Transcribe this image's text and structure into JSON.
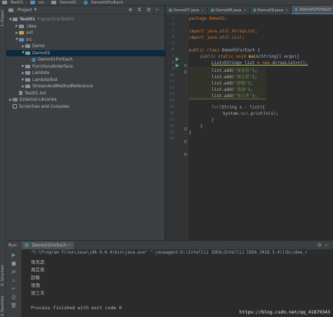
{
  "breadcrumb": [
    "Test01",
    "src",
    "Demo02",
    "Demo01ForEach"
  ],
  "project_panel": {
    "title": "Project",
    "tree": [
      {
        "label": "Test01",
        "suffix": "F:\\practice\\Test01",
        "depth": 0,
        "expanded": true,
        "icon": "folder-plain"
      },
      {
        "label": ".idea",
        "depth": 1,
        "expanded": false,
        "icon": "folder-plain"
      },
      {
        "label": "out",
        "depth": 1,
        "expanded": false,
        "icon": "folder-orange"
      },
      {
        "label": "src",
        "depth": 1,
        "expanded": true,
        "icon": "folder-blue"
      },
      {
        "label": "Demo",
        "depth": 2,
        "expanded": false,
        "icon": "folder-plain"
      },
      {
        "label": "Demo02",
        "depth": 2,
        "expanded": true,
        "icon": "folder-plain",
        "selected": true
      },
      {
        "label": "Demo01ForEach",
        "depth": 3,
        "icon": "class"
      },
      {
        "label": "FunctionalInterface",
        "depth": 2,
        "expanded": false,
        "icon": "folder-plain"
      },
      {
        "label": "Lambda",
        "depth": 2,
        "expanded": false,
        "icon": "folder-plain"
      },
      {
        "label": "LambdaTest",
        "depth": 2,
        "expanded": false,
        "icon": "folder-plain"
      },
      {
        "label": "StreamAndMethodReference",
        "depth": 2,
        "expanded": false,
        "icon": "folder-plain"
      },
      {
        "label": "Test01.iml",
        "depth": 1,
        "icon": "file"
      },
      {
        "label": "External Libraries",
        "depth": 0,
        "expanded": false,
        "icon": "library"
      },
      {
        "label": "Scratches and Consoles",
        "depth": 0,
        "icon": "scratch"
      }
    ]
  },
  "editor": {
    "tabs": [
      {
        "label": "Demo07.java",
        "active": false
      },
      {
        "label": "Demo08.java",
        "active": false
      },
      {
        "label": "Demo09.java",
        "active": false
      },
      {
        "label": "Demo01ForEach",
        "active": true
      }
    ],
    "line_numbers": [
      "1",
      "2",
      "3",
      "4",
      "5",
      "6",
      "7",
      "8",
      "9",
      "10",
      "11",
      "12",
      "13",
      "14",
      "15",
      "16",
      "17",
      "18",
      "19",
      "20"
    ],
    "code": {
      "l1": [
        "package Demo02;"
      ],
      "l3": [
        "import java.util.ArrayList;"
      ],
      "l4": [
        "import java.util.List;"
      ],
      "l6": [
        "public class",
        " Demo01ForEach {"
      ],
      "l7": [
        "public static void",
        " ",
        "main",
        "(String[] args){"
      ],
      "l8": [
        "List<String> list = ",
        "new",
        " ArrayList<>();"
      ],
      "l9": [
        "list.add(",
        "\"张无忌\"",
        ");"
      ],
      "l10": [
        "list.add(",
        "\"周芷若\"",
        ");"
      ],
      "l11": [
        "list.add(",
        "\"赵敏\"",
        ");"
      ],
      "l12": [
        "list.add(",
        "\"张强\"",
        ");"
      ],
      "l13": [
        "list.add(",
        "\"张三丰\"",
        ");"
      ],
      "l15": [
        "for",
        "(String s : list){"
      ],
      "l16": [
        "System.",
        "out",
        ".println(s);"
      ],
      "l17": [
        "}"
      ],
      "l18": [
        "}"
      ],
      "l19": [
        "}"
      ]
    }
  },
  "run_panel": {
    "label": "Run:",
    "tab": "Demo01ForEach",
    "command": "\"C:\\Program Files\\Java\\jdk-9.0.4\\bin\\java.exe\" \"-javaagent:D:\\IntelliJ IDEA\\IntelliJ IDEA 2018.3.4\\lib\\idea_r",
    "output": [
      "张无忌",
      "周芷若",
      "赵敏",
      "张强",
      "张三丰"
    ],
    "exit_message": "Process finished with exit code 0"
  },
  "side_labels": {
    "project": "1: Project",
    "structure": "Z: Structure",
    "favorites": "2: Favorites"
  },
  "watermark": "https://blog.csdn.net/qq_41879343",
  "colors": {
    "keyword": "#cc7832",
    "string": "#6a8759",
    "method": "#ffc66d",
    "field": "#9876aa",
    "selection": "#0d293e"
  }
}
